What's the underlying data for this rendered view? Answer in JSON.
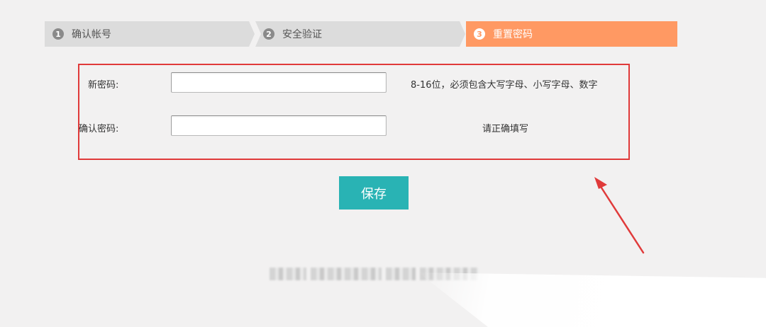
{
  "steps": [
    {
      "num": "1",
      "label": "确认帐号"
    },
    {
      "num": "2",
      "label": "安全验证"
    },
    {
      "num": "3",
      "label": "重置密码"
    }
  ],
  "form": {
    "new_password": {
      "label": "新密码:",
      "value": "",
      "hint": "8-16位，必须包含大写字母、小写字母、数字"
    },
    "confirm_password": {
      "label": "确认密码:",
      "value": "",
      "hint": "请正确填写"
    }
  },
  "save_label": "保存",
  "colors": {
    "active_step": "#ff9963",
    "inactive_step": "#dcdcdc",
    "save_button": "#29b3b4",
    "highlight_box": "#e03a3a",
    "annotation_arrow": "#e03a3a"
  }
}
